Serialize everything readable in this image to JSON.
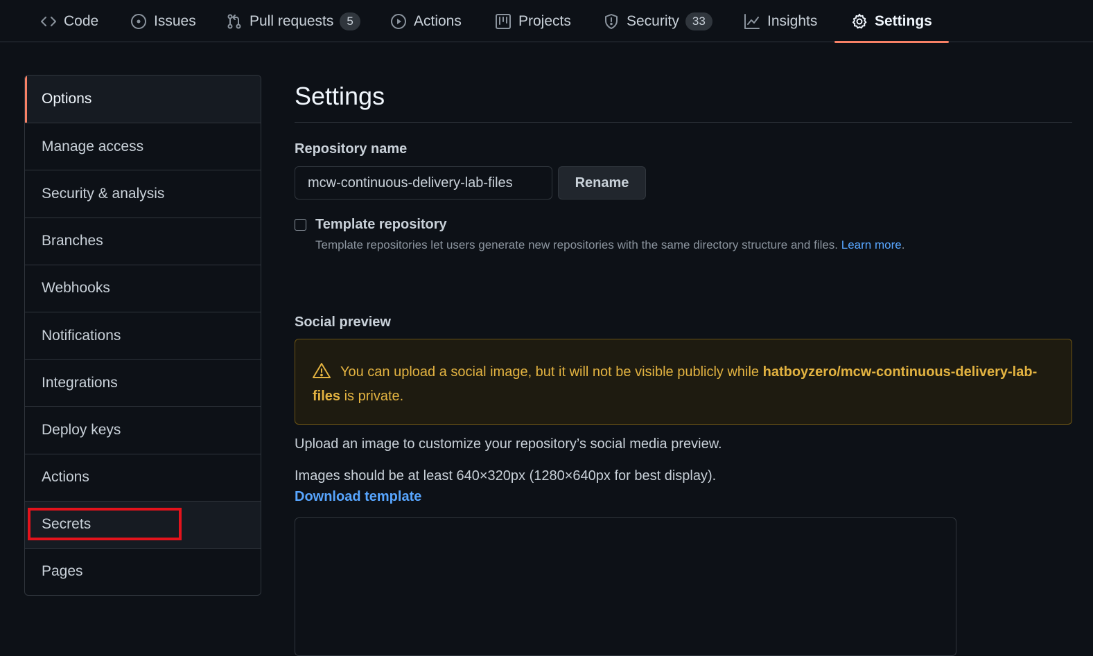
{
  "nav": {
    "tabs": [
      {
        "label": "Code",
        "icon": "code-icon"
      },
      {
        "label": "Issues",
        "icon": "issue-icon"
      },
      {
        "label": "Pull requests",
        "icon": "pull-request-icon",
        "count": "5"
      },
      {
        "label": "Actions",
        "icon": "play-icon"
      },
      {
        "label": "Projects",
        "icon": "project-icon"
      },
      {
        "label": "Security",
        "icon": "shield-icon",
        "count": "33"
      },
      {
        "label": "Insights",
        "icon": "graph-icon"
      },
      {
        "label": "Settings",
        "icon": "gear-icon",
        "selected": true
      }
    ]
  },
  "sidebar": {
    "items": [
      {
        "label": "Options",
        "selected": true
      },
      {
        "label": "Manage access"
      },
      {
        "label": "Security & analysis"
      },
      {
        "label": "Branches"
      },
      {
        "label": "Webhooks"
      },
      {
        "label": "Notifications"
      },
      {
        "label": "Integrations"
      },
      {
        "label": "Deploy keys"
      },
      {
        "label": "Actions"
      },
      {
        "label": "Secrets",
        "highlighted": true
      },
      {
        "label": "Pages"
      }
    ]
  },
  "main": {
    "title": "Settings",
    "repo_name_label": "Repository name",
    "repo_name_value": "mcw-continuous-delivery-lab-files",
    "rename_label": "Rename",
    "template_label": "Template repository",
    "template_note": "Template repositories let users generate new repositories with the same directory structure and files.",
    "learn_more": "Learn more",
    "template_note_end": ".",
    "social_label": "Social preview",
    "warning_prefix": "You can upload a social image, but it will not be visible publicly while",
    "warning_repo": "hatboyzero/mcw-continuous-delivery-lab-files",
    "warning_suffix": "is private.",
    "upload_text": "Upload an image to customize your repository’s social media preview.",
    "size_text": "Images should be at least 640×320px (1280×640px for best display).",
    "download_template": "Download template"
  },
  "colors": {
    "background": "#0d1117",
    "accent": "#f78166",
    "link": "#58a6ff",
    "warning": "#e3b341",
    "highlight_box": "#e3131c"
  }
}
